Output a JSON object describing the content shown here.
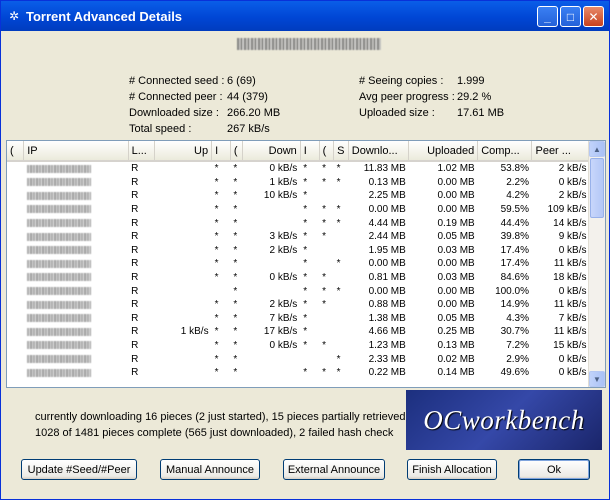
{
  "window": {
    "title": "Torrent Advanced Details"
  },
  "stats": {
    "connected_seed_label": "# Connected seed :",
    "connected_seed_value": "6 (69)",
    "connected_peer_label": "# Connected peer :",
    "connected_peer_value": "44 (379)",
    "downloaded_size_label": "Downloaded size :",
    "downloaded_size_value": "266.20 MB",
    "total_speed_label": "Total speed :",
    "total_speed_value": "267 kB/s",
    "seeing_copies_label": "# Seeing copies :",
    "seeing_copies_value": "1.999",
    "avg_peer_progress_label": "Avg peer progress :",
    "avg_peer_progress_value": "29.2 %",
    "uploaded_size_label": "Uploaded size :",
    "uploaded_size_value": "17.61 MB"
  },
  "table": {
    "columns": [
      "(",
      "IP",
      "L...",
      "Up",
      "I",
      "(",
      "Down",
      "I",
      "(",
      "S",
      "Downlo...",
      "Uploaded",
      "Comp...",
      "Peer ..."
    ],
    "rows": [
      [
        "R",
        "",
        "*",
        "*",
        "0 kB/s",
        "*",
        "*",
        "*",
        "11.83 MB",
        "1.02 MB",
        "53.8%",
        "2 kB/s"
      ],
      [
        "R",
        "",
        "*",
        "*",
        "1 kB/s",
        "*",
        "*",
        "*",
        "0.13 MB",
        "0.00 MB",
        "2.2%",
        "0 kB/s"
      ],
      [
        "R",
        "",
        "*",
        "*",
        "10 kB/s",
        "*",
        "",
        "",
        "2.25 MB",
        "0.00 MB",
        "4.2%",
        "2 kB/s"
      ],
      [
        "R",
        "",
        "*",
        "*",
        "",
        "*",
        "*",
        "*",
        "0.00 MB",
        "0.00 MB",
        "59.5%",
        "109 kB/s"
      ],
      [
        "R",
        "",
        "*",
        "*",
        "",
        "*",
        "*",
        "*",
        "4.44 MB",
        "0.19 MB",
        "44.4%",
        "14 kB/s"
      ],
      [
        "R",
        "",
        "*",
        "*",
        "3 kB/s",
        "*",
        "*",
        "",
        "2.44 MB",
        "0.05 MB",
        "39.8%",
        "9 kB/s"
      ],
      [
        "R",
        "",
        "*",
        "*",
        "2 kB/s",
        "*",
        "",
        "",
        "1.95 MB",
        "0.03 MB",
        "17.4%",
        "0 kB/s"
      ],
      [
        "R",
        "",
        "*",
        "*",
        "",
        "*",
        "",
        "*",
        "0.00 MB",
        "0.00 MB",
        "17.4%",
        "11 kB/s"
      ],
      [
        "R",
        "",
        "*",
        "*",
        "0 kB/s",
        "*",
        "*",
        "",
        "0.81 MB",
        "0.03 MB",
        "84.6%",
        "18 kB/s"
      ],
      [
        "R",
        "",
        "",
        "*",
        "",
        "*",
        "*",
        "*",
        "0.00 MB",
        "0.00 MB",
        "100.0%",
        "0 kB/s"
      ],
      [
        "R",
        "",
        "*",
        "*",
        "2 kB/s",
        "*",
        "*",
        "",
        "0.88 MB",
        "0.00 MB",
        "14.9%",
        "11 kB/s"
      ],
      [
        "R",
        "",
        "*",
        "*",
        "7 kB/s",
        "*",
        "",
        "",
        "1.38 MB",
        "0.05 MB",
        "4.3%",
        "7 kB/s"
      ],
      [
        "R",
        "1 kB/s",
        "*",
        "*",
        "17 kB/s",
        "*",
        "",
        "",
        "4.66 MB",
        "0.25 MB",
        "30.7%",
        "11 kB/s"
      ],
      [
        "R",
        "",
        "*",
        "*",
        "0 kB/s",
        "*",
        "*",
        "",
        "1.23 MB",
        "0.13 MB",
        "7.2%",
        "15 kB/s"
      ],
      [
        "R",
        "",
        "*",
        "*",
        "",
        "",
        "",
        "*",
        "2.33 MB",
        "0.02 MB",
        "2.9%",
        "0 kB/s"
      ],
      [
        "R",
        "",
        "*",
        "*",
        "",
        "*",
        "*",
        "*",
        "0.22 MB",
        "0.14 MB",
        "49.6%",
        "0 kB/s"
      ]
    ]
  },
  "status": {
    "line1": "currently downloading 16 pieces (2 just started), 15 pieces partially retrieved",
    "line2": "1028 of 1481 pieces complete (565 just downloaded), 2 failed hash check"
  },
  "logo": {
    "text": "OCworkbench"
  },
  "buttons": {
    "update": "Update #Seed/#Peer",
    "manual": "Manual Announce",
    "external": "External Announce",
    "finish": "Finish Allocation",
    "ok": "Ok"
  },
  "colors": {
    "titlebar": "#0046d5",
    "dialog_bg": "#ece9d8",
    "logo_bg": "#2a3d96"
  }
}
